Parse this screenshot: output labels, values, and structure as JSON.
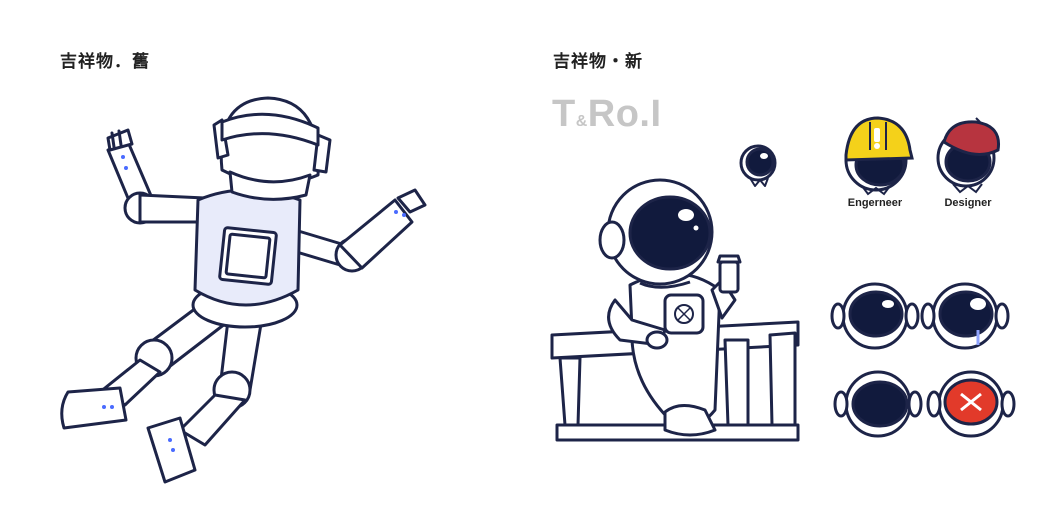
{
  "titles": {
    "old": "吉祥物．舊",
    "new": "吉祥物・新"
  },
  "brand": {
    "part1": "T",
    "amp": "&",
    "part2": "Ro.I"
  },
  "captions": {
    "engineer": "Engerneer",
    "designer": "Designer"
  },
  "colors": {
    "outline": "#1d2448",
    "visor": "#111a3d",
    "suit_fill": "#e8ebfa",
    "dot": "#4a6bff",
    "helmet_yellow": "#f4d11a",
    "beret_red": "#b7343f",
    "x_red": "#e23a2a",
    "brand_grey": "#c6c6c6"
  }
}
